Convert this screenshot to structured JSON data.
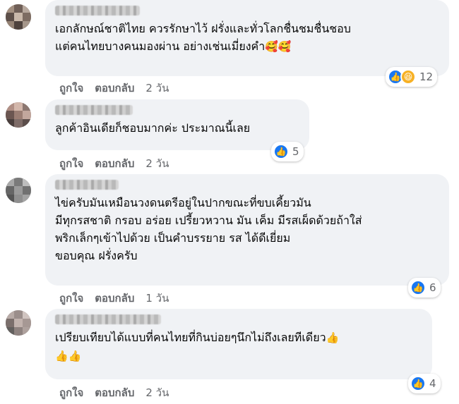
{
  "comments": [
    {
      "text": "เอกลักษณ์ชาติไทย ควรรักษาไว้ ฝรั่งและทั่วโลกชื่นชมชื่นชอบ\nแต่คนไทยบางคนมองผ่าน อย่างเช่นเมี่ยงคำ",
      "emoji": "🥰🥰",
      "like_label": "ถูกใจ",
      "reply_label": "ตอบกลับ",
      "time": "2 วัน",
      "reaction_count": "12",
      "reactions": [
        "like-icon",
        "haha-icon"
      ]
    },
    {
      "text": "ลูกค้าอินเดียก็ชอบมากค่ะ ประมาณนี้เลย",
      "emoji": "",
      "like_label": "ถูกใจ",
      "reply_label": "ตอบกลับ",
      "time": "2 วัน",
      "reaction_count": "5",
      "reactions": [
        "like-icon"
      ]
    },
    {
      "text": "ไข่ครับมันเหมือนวงดนตรีอยู่ในปากขณะที่ขบเคี้ยวมัน\nมีทุกรสชาติ กรอบ อร่อย เปรี้ยวหวาน มัน เค็ม มีรสเผ็ดด้วยถ้าใส่\nพริกเล็กๆเข้าไปด้วย เป็นคำบรรยาย รส ได้ดีเยี่ยม\nขอบคุณ ฝรั่งครับ",
      "emoji": "",
      "like_label": "ถูกใจ",
      "reply_label": "ตอบกลับ",
      "time": "1 วัน",
      "reaction_count": "6",
      "reactions": [
        "like-icon"
      ]
    },
    {
      "text": "เปรียบเทียบได้แบบที่คนไทยที่กินบ่อยๆนึกไม่ถึงเลยทีเดียว",
      "emoji": "👍",
      "emoji_line2": "👍👍",
      "like_label": "ถูกใจ",
      "reply_label": "ตอบกลับ",
      "time": "2 วัน",
      "reaction_count": "4",
      "reactions": [
        "like-icon"
      ]
    }
  ],
  "colors": {
    "bubble": "#f0f2f5",
    "like_blue": "#1877f2",
    "haha_yellow": "#f7b125",
    "meta_gray": "#65676b"
  }
}
